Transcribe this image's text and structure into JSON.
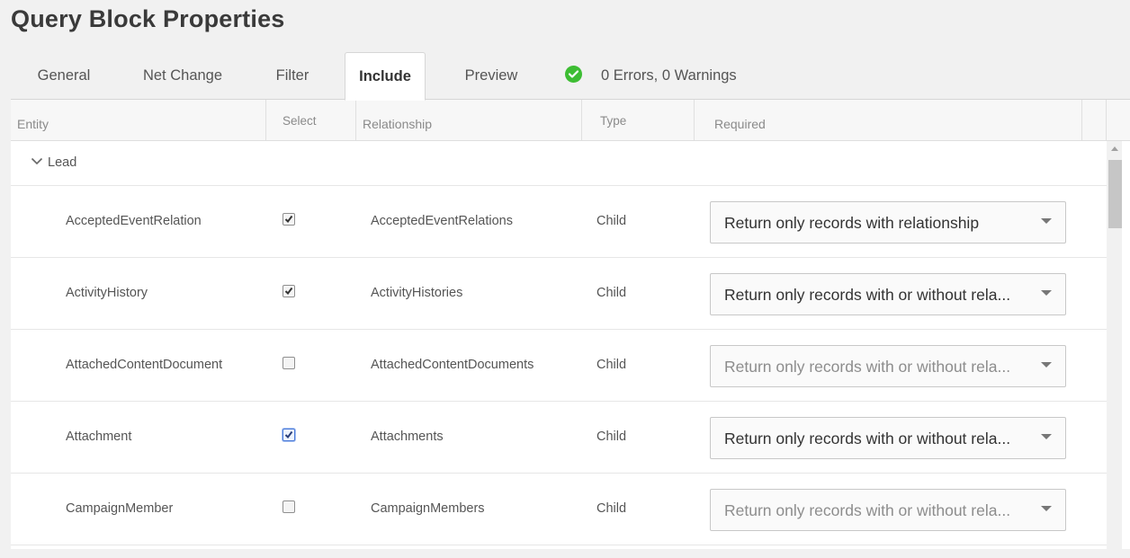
{
  "page": {
    "title": "Query Block Properties"
  },
  "tabs": [
    {
      "label": "General",
      "active": false
    },
    {
      "label": "Net Change",
      "active": false
    },
    {
      "label": "Filter",
      "active": false
    },
    {
      "label": "Include",
      "active": true
    },
    {
      "label": "Preview",
      "active": false
    }
  ],
  "status": {
    "text": "0 Errors, 0 Warnings",
    "icon": "check-circle-icon",
    "color": "#3dbd33"
  },
  "table": {
    "columns": [
      "Entity",
      "Select",
      "Relationship",
      "Type",
      "Required"
    ],
    "group": {
      "label": "Lead",
      "expanded": true
    },
    "rows": [
      {
        "entity": "AcceptedEventRelation",
        "selected": true,
        "relationship": "AcceptedEventRelations",
        "type": "Child",
        "required": "Return only records with relationship",
        "enabled": true
      },
      {
        "entity": "ActivityHistory",
        "selected": true,
        "relationship": "ActivityHistories",
        "type": "Child",
        "required": "Return only records with or without rela...",
        "enabled": true
      },
      {
        "entity": "AttachedContentDocument",
        "selected": false,
        "relationship": "AttachedContentDocuments",
        "type": "Child",
        "required": "Return only records with or without rela...",
        "enabled": false
      },
      {
        "entity": "Attachment",
        "selected": true,
        "relationship": "Attachments",
        "type": "Child",
        "required": "Return only records with or without rela...",
        "enabled": true
      },
      {
        "entity": "CampaignMember",
        "selected": false,
        "relationship": "CampaignMembers",
        "type": "Child",
        "required": "Return only records with or without rela...",
        "enabled": false
      }
    ]
  }
}
